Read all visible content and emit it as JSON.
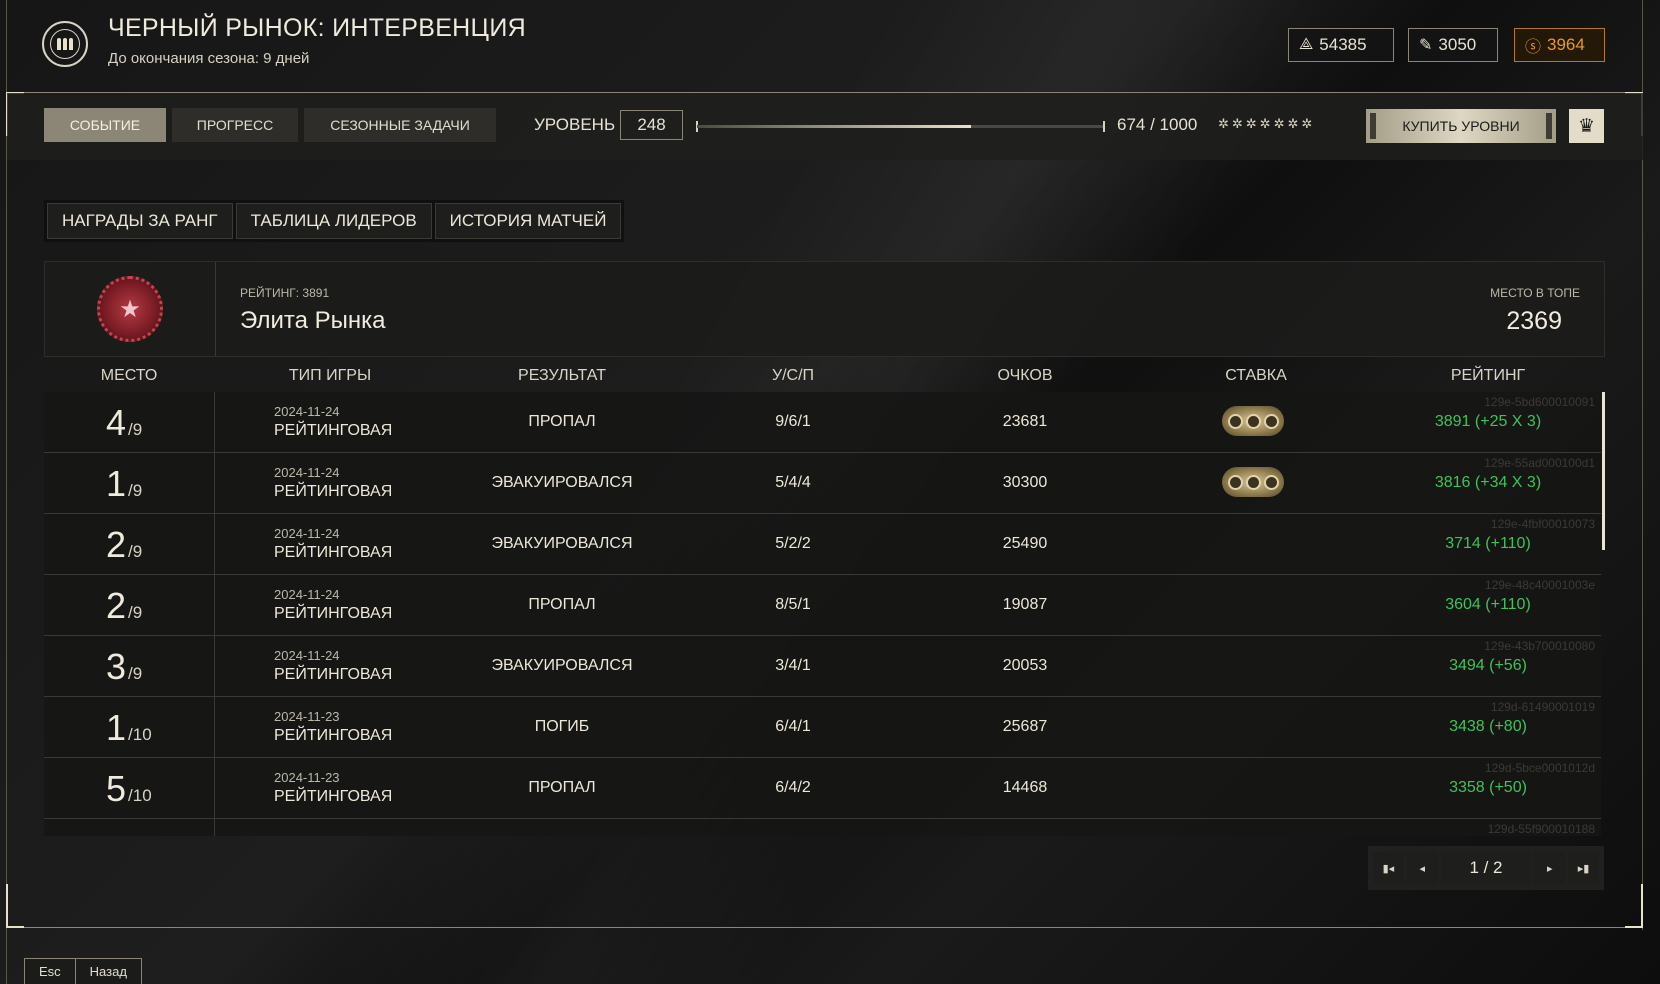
{
  "header": {
    "title": "ЧЕРНЫЙ РЫНОК: ИНТЕРВЕНЦИЯ",
    "subtitle": "До окончания сезона: 9 дней",
    "currencies": [
      {
        "icon": "crystal-icon",
        "value": "54385"
      },
      {
        "icon": "ticket-icon",
        "value": "3050"
      },
      {
        "icon": "sc-coin-icon",
        "value": "3964",
        "color": "#e59a2a"
      }
    ]
  },
  "nav": {
    "tabs": [
      {
        "label": "СОБЫТИЕ",
        "active": true
      },
      {
        "label": "ПРОГРЕСС",
        "active": false
      },
      {
        "label": "СЕЗОННЫЕ ЗАДАЧИ",
        "active": false
      }
    ],
    "level_label": "УРОВЕНЬ",
    "level_value": "248",
    "progress_current": 674,
    "progress_max": 1000,
    "progress_text": "674 / 1000",
    "stars": "✲✲✲✲✲✲✲",
    "buy_label": "КУПИТЬ УРОВНИ",
    "crown_icon": "crown-icon"
  },
  "subtabs": [
    "НАГРАДЫ ЗА РАНГ",
    "ТАБЛИЦА ЛИДЕРОВ",
    "ИСТОРИЯ МАТЧЕЙ"
  ],
  "rank": {
    "rating_label": "РЕЙТИНГ: 3891",
    "name": "Элита Рынка",
    "top_label": "МЕСТО В ТОПЕ",
    "top_value": "2369",
    "emblem_color": "#b53a44"
  },
  "table": {
    "headers": [
      "МЕСТО",
      "ТИП ИГРЫ",
      "РЕЗУЛЬТАТ",
      "У/С/П",
      "ОЧКОВ",
      "СТАВКА",
      "РЕЙТИНГ"
    ],
    "rating_color": "#3fc25a",
    "rows": [
      {
        "place": "4",
        "of": "/9",
        "date": "2024-11-24",
        "type": "РЕЙТИНГОВАЯ",
        "result": "ПРОПАЛ",
        "usp": "9/6/1",
        "points": "23681",
        "bet": true,
        "rating": "3891 (+25 X 3)",
        "id": "129e-5bd600010091"
      },
      {
        "place": "1",
        "of": "/9",
        "date": "2024-11-24",
        "type": "РЕЙТИНГОВАЯ",
        "result": "ЭВАКУИРОВАЛСЯ",
        "usp": "5/4/4",
        "points": "30300",
        "bet": true,
        "rating": "3816 (+34 X 3)",
        "id": "129e-55ad000100d1"
      },
      {
        "place": "2",
        "of": "/9",
        "date": "2024-11-24",
        "type": "РЕЙТИНГОВАЯ",
        "result": "ЭВАКУИРОВАЛСЯ",
        "usp": "5/2/2",
        "points": "25490",
        "bet": false,
        "rating": "3714 (+110)",
        "id": "129e-4fbf00010073"
      },
      {
        "place": "2",
        "of": "/9",
        "date": "2024-11-24",
        "type": "РЕЙТИНГОВАЯ",
        "result": "ПРОПАЛ",
        "usp": "8/5/1",
        "points": "19087",
        "bet": false,
        "rating": "3604 (+110)",
        "id": "129e-48c40001003e"
      },
      {
        "place": "3",
        "of": "/9",
        "date": "2024-11-24",
        "type": "РЕЙТИНГОВАЯ",
        "result": "ЭВАКУИРОВАЛСЯ",
        "usp": "3/4/1",
        "points": "20053",
        "bet": false,
        "rating": "3494 (+56)",
        "id": "129e-43b700010080"
      },
      {
        "place": "1",
        "of": "/10",
        "date": "2024-11-23",
        "type": "РЕЙТИНГОВАЯ",
        "result": "ПОГИБ",
        "usp": "6/4/1",
        "points": "25687",
        "bet": false,
        "rating": "3438 (+80)",
        "id": "129d-61490001019"
      },
      {
        "place": "5",
        "of": "/10",
        "date": "2024-11-23",
        "type": "РЕЙТИНГОВАЯ",
        "result": "ПРОПАЛ",
        "usp": "6/4/2",
        "points": "14468",
        "bet": false,
        "rating": "3358 (+50)",
        "id": "129d-5bce0001012d"
      },
      {
        "place": "",
        "of": "",
        "date": "",
        "type": "",
        "result": "",
        "usp": "",
        "points": "",
        "bet": false,
        "rating": "",
        "id": "129d-55f900010188"
      }
    ]
  },
  "pager": {
    "text": "1 / 2",
    "first_icon": "first-page-icon",
    "prev_icon": "prev-page-icon",
    "next_icon": "next-page-icon",
    "last_icon": "last-page-icon"
  },
  "footer": {
    "key": "Esc",
    "label": "Назад"
  }
}
